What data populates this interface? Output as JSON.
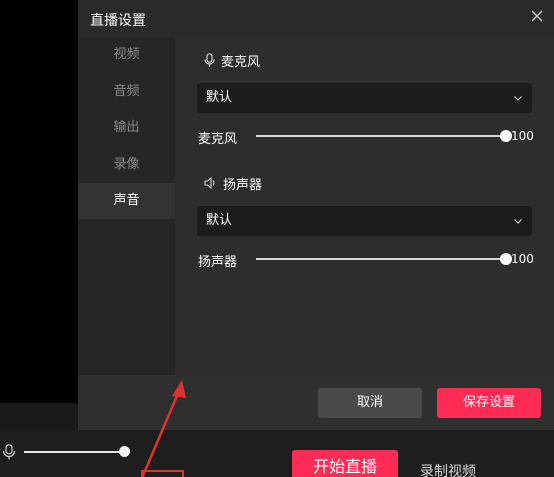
{
  "dialog": {
    "title": "直播设置",
    "nav": [
      {
        "label": "视频"
      },
      {
        "label": "音频"
      },
      {
        "label": "输出"
      },
      {
        "label": "录像"
      },
      {
        "label": "声音",
        "active": true
      }
    ],
    "microphone": {
      "section_title": "麦克风",
      "icon": "microphone-icon",
      "device_value": "默认",
      "volume_label": "麦克风",
      "volume_value": "100",
      "volume_fraction": 1.0
    },
    "speaker": {
      "section_title": "扬声器",
      "icon": "speaker-icon",
      "device_value": "默认",
      "volume_label": "扬声器",
      "volume_value": "100",
      "volume_fraction": 1.0
    },
    "buttons": {
      "cancel": "取消",
      "save": "保存设置"
    }
  },
  "bottom_bar": {
    "mic_level_fraction": 1.0,
    "start_live": "开始直播",
    "record_video": "录制视频"
  },
  "colors": {
    "accent": "#fe2c55",
    "dialog_bg": "#2a2a2a",
    "annotation": "#e0332f"
  }
}
